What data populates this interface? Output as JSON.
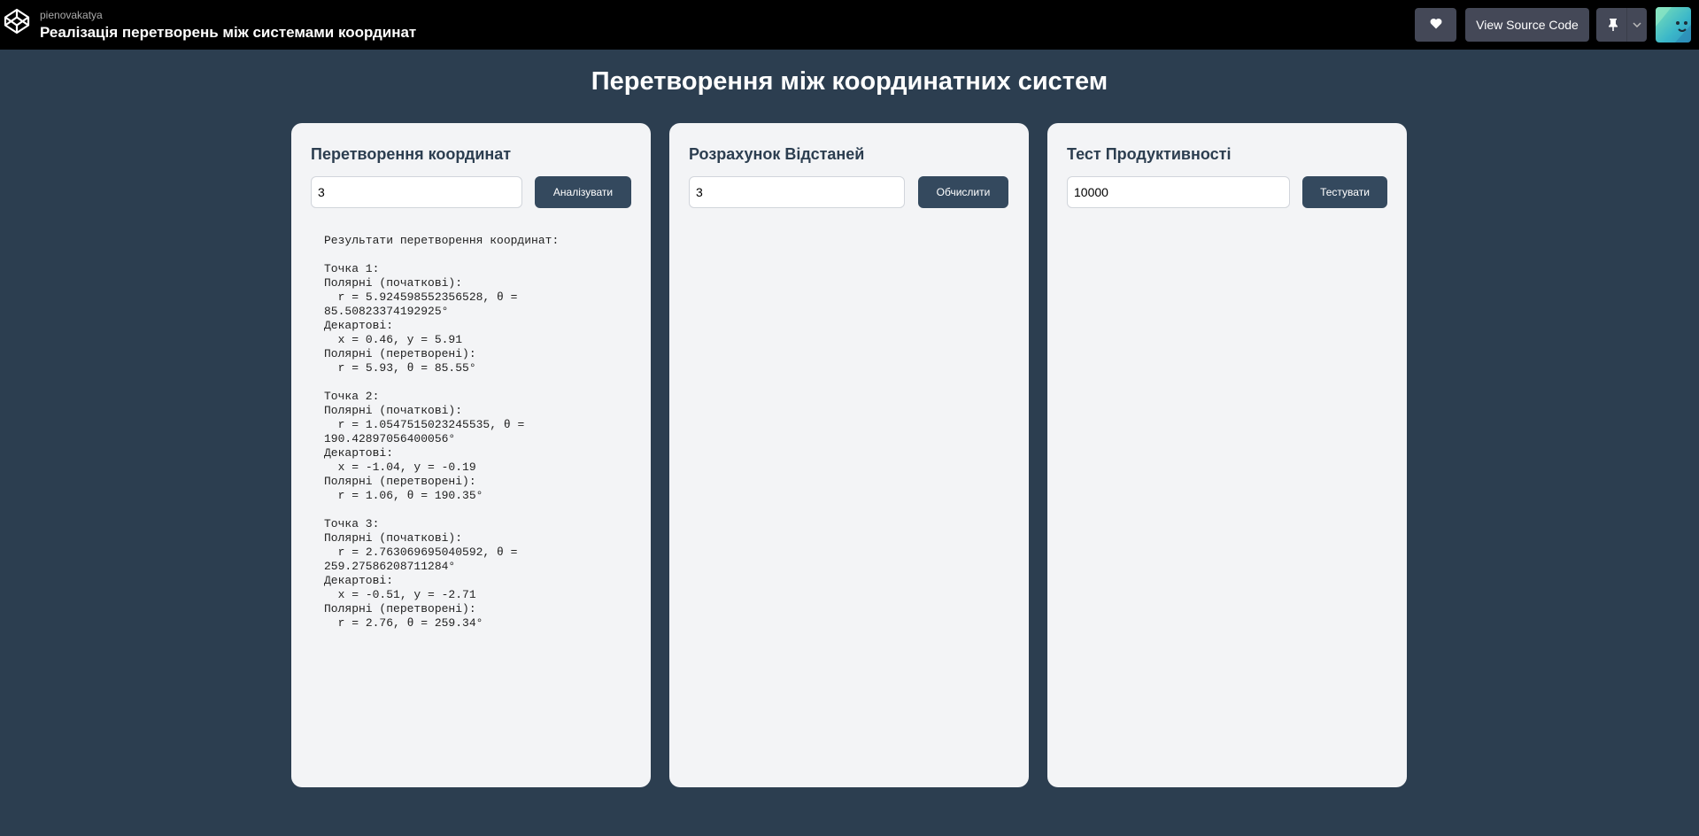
{
  "topbar": {
    "author": "pienovakatya",
    "pen_title": "Реалізація перетворень між системами координат",
    "source_button": "View Source Code",
    "icons": {
      "logo": "codepen-logo-icon",
      "heart": "heart-icon",
      "pin": "pin-icon",
      "chevron": "chevron-down-icon"
    }
  },
  "page": {
    "heading": "Перетворення між координатних систем"
  },
  "cards": {
    "conversion": {
      "title": "Перетворення координат",
      "input_value": "3",
      "button": "Аналізувати",
      "results": "Результати перетворення координат:\n\nТочка 1:\nПолярні (початкові):\n  r = 5.924598552356528, θ = 85.50823374192925°\nДекартові:\n  x = 0.46, y = 5.91\nПолярні (перетворені):\n  r = 5.93, θ = 85.55°\n\nТочка 2:\nПолярні (початкові):\n  r = 1.0547515023245535, θ = 190.42897056400056°\nДекартові:\n  x = -1.04, y = -0.19\nПолярні (перетворені):\n  r = 1.06, θ = 190.35°\n\nТочка 3:\nПолярні (початкові):\n  r = 2.763069695040592, θ = 259.27586208711284°\nДекартові:\n  x = -0.51, y = -2.71\nПолярні (перетворені):\n  r = 2.76, θ = 259.34°"
    },
    "distance": {
      "title": "Розрахунок Відстаней",
      "input_value": "3",
      "button": "Обчислити"
    },
    "performance": {
      "title": "Тест Продуктивності",
      "input_value": "10000",
      "button": "Тестувати"
    }
  },
  "colors": {
    "background": "#2c3e50",
    "card": "#f3f4f6",
    "button": "#34495e",
    "topbar": "#000000",
    "topbar_button": "#444857"
  }
}
